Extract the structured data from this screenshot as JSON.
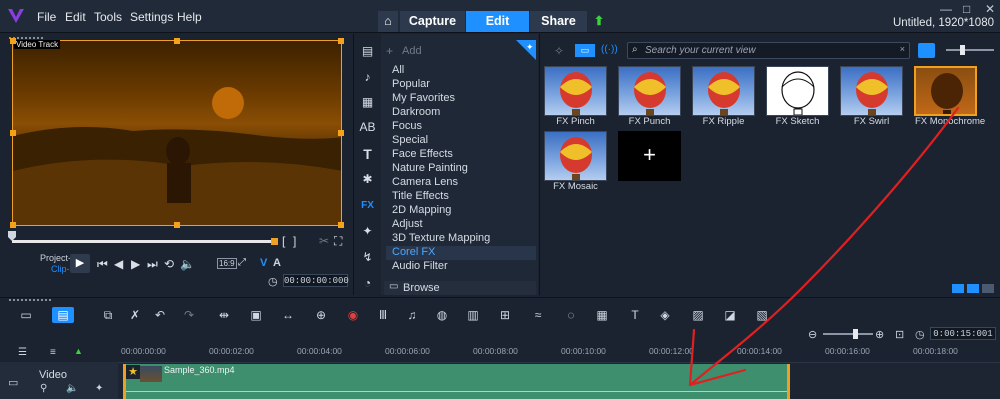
{
  "menubar": {
    "items": [
      "File",
      "Edit",
      "Tools",
      "Settings",
      "Help"
    ],
    "tabs": [
      "Capture",
      "Edit",
      "Share"
    ],
    "project_info": "Untitled, 1920*1080"
  },
  "player": {
    "track_label": "Video Track",
    "project_label": "Project-",
    "clip_label": "Clip-",
    "aspect": "16:9",
    "timecode": "00:00:00:000"
  },
  "library": {
    "add_label": "Add",
    "categories": [
      "All",
      "Popular",
      "My Favorites",
      "Darkroom",
      "Focus",
      "Special",
      "Face Effects",
      "Nature Painting",
      "Camera Lens",
      "Title Effects",
      "2D Mapping",
      "Adjust",
      "3D Texture Mapping",
      "Corel FX",
      "Audio Filter"
    ],
    "selected_category": "Corel FX",
    "browse_label": "Browse",
    "search_placeholder": "Search your current view"
  },
  "effects": [
    {
      "label": "FX Pinch",
      "style": "balloon"
    },
    {
      "label": "FX Punch",
      "style": "balloon"
    },
    {
      "label": "FX Ripple",
      "style": "balloon"
    },
    {
      "label": "FX Sketch",
      "style": "sketch"
    },
    {
      "label": "FX Swirl",
      "style": "balloon"
    },
    {
      "label": "FX Monochrome",
      "style": "mono"
    },
    {
      "label": "FX Mosaic",
      "style": "balloon"
    },
    {
      "label": "+",
      "style": "add"
    }
  ],
  "timeline": {
    "zoom_timecode": "0:00:15:001",
    "ruler": [
      "00:00:00:00",
      "00:00:02:00",
      "00:00:04:00",
      "00:00:06:00",
      "00:00:08:00",
      "00:00:10:00",
      "00:00:12:00",
      "00:00:14:00",
      "00:00:16:00",
      "00:00:18:00"
    ],
    "track_name": "Video",
    "clip_name": "Sample_360.mp4"
  },
  "colors": {
    "accent": "#1e90ff",
    "clip": "#3e8f6d",
    "handle": "#f0a020",
    "annotation": "#e02020"
  }
}
